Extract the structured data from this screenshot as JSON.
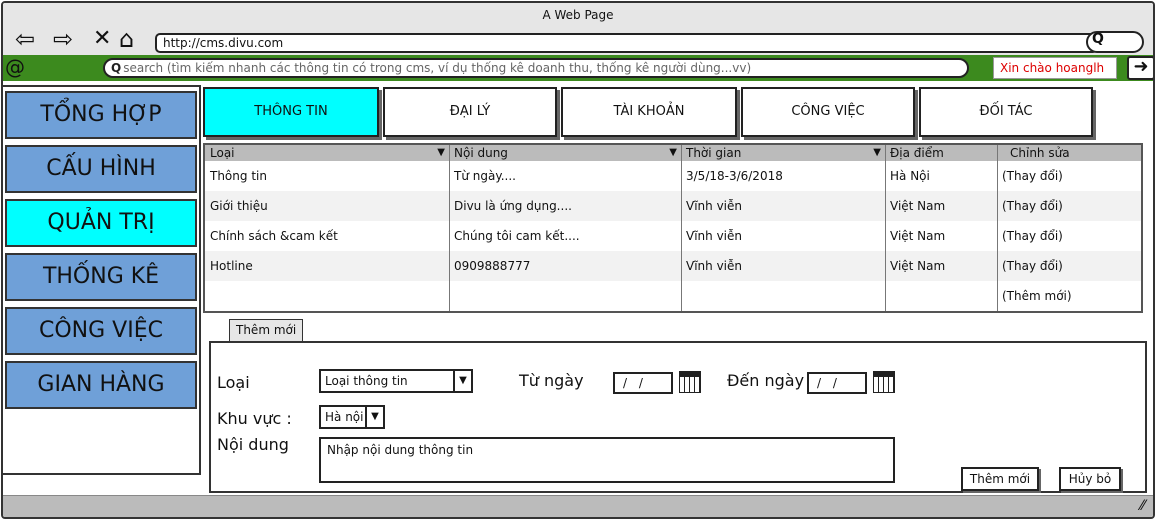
{
  "browser": {
    "title": "A Web Page",
    "url": "http://cms.divu.com"
  },
  "appbar": {
    "search_placeholder": "search (tìm kiếm nhanh các thông tin có trong cms, ví dụ thống kê doanh thu, thống kê người dùng...vv)",
    "greeting": "Xin chào hoanglh"
  },
  "sidebar": {
    "items": [
      {
        "label": "TỔNG HỢP"
      },
      {
        "label": "CẤU HÌNH"
      },
      {
        "label": "QUẢN TRỊ"
      },
      {
        "label": "THỐNG KÊ"
      },
      {
        "label": "CÔNG VIỆC"
      },
      {
        "label": "GIAN HÀNG"
      }
    ]
  },
  "tabs": [
    {
      "label": "THÔNG TIN"
    },
    {
      "label": "ĐẠI LÝ"
    },
    {
      "label": "TÀI KHOẢN"
    },
    {
      "label": "CÔNG VIỆC"
    },
    {
      "label": "ĐỐI TÁC"
    }
  ],
  "table": {
    "headers": [
      "Loại",
      "Nội dung",
      "Thời gian",
      "Địa điểm",
      "Chỉnh sửa"
    ],
    "rows": [
      [
        "Thông tin",
        "Từ ngày....",
        "3/5/18-3/6/2018",
        "Hà Nội",
        "(Thay đổi)"
      ],
      [
        "Giới thiệu",
        "Divu là ứng dụng....",
        "Vĩnh viễn",
        "Việt Nam",
        "(Thay đổi)"
      ],
      [
        "Chính sách &cam kết",
        "Chúng tôi cam kết....",
        "Vĩnh viễn",
        "Việt Nam",
        "(Thay đổi)"
      ],
      [
        "Hotline",
        "0909888777",
        "Vĩnh viễn",
        "Việt Nam",
        "(Thay đổi)"
      ],
      [
        "",
        "",
        "",
        "",
        "(Thêm mới)"
      ]
    ]
  },
  "form": {
    "tab_label": "Thêm mới",
    "type_label": "Loại",
    "type_value": "Loại thông tin",
    "from_label": "Từ ngày",
    "from_value": "/ /",
    "to_label": "Đến ngày",
    "to_value": "/ /",
    "region_label": "Khu vực :",
    "region_value": "Hà nội",
    "content_label": "Nội dung",
    "content_placeholder": "Nhập nội dung thông tin",
    "add_button": "Thêm mới",
    "cancel_button": "Hủy bỏ"
  },
  "icons": {
    "back": "back-arrow-icon",
    "forward": "forward-arrow-icon",
    "close": "close-icon",
    "home": "home-icon",
    "search": "search-icon",
    "calendar": "calendar-icon",
    "logout": "logout-arrow-icon"
  },
  "colors": {
    "accent_cyan": "#00ffff",
    "sidebar_blue": "#6fa0d8",
    "appbar_green": "#3c8a1e",
    "greeting_red": "#dd0000"
  }
}
